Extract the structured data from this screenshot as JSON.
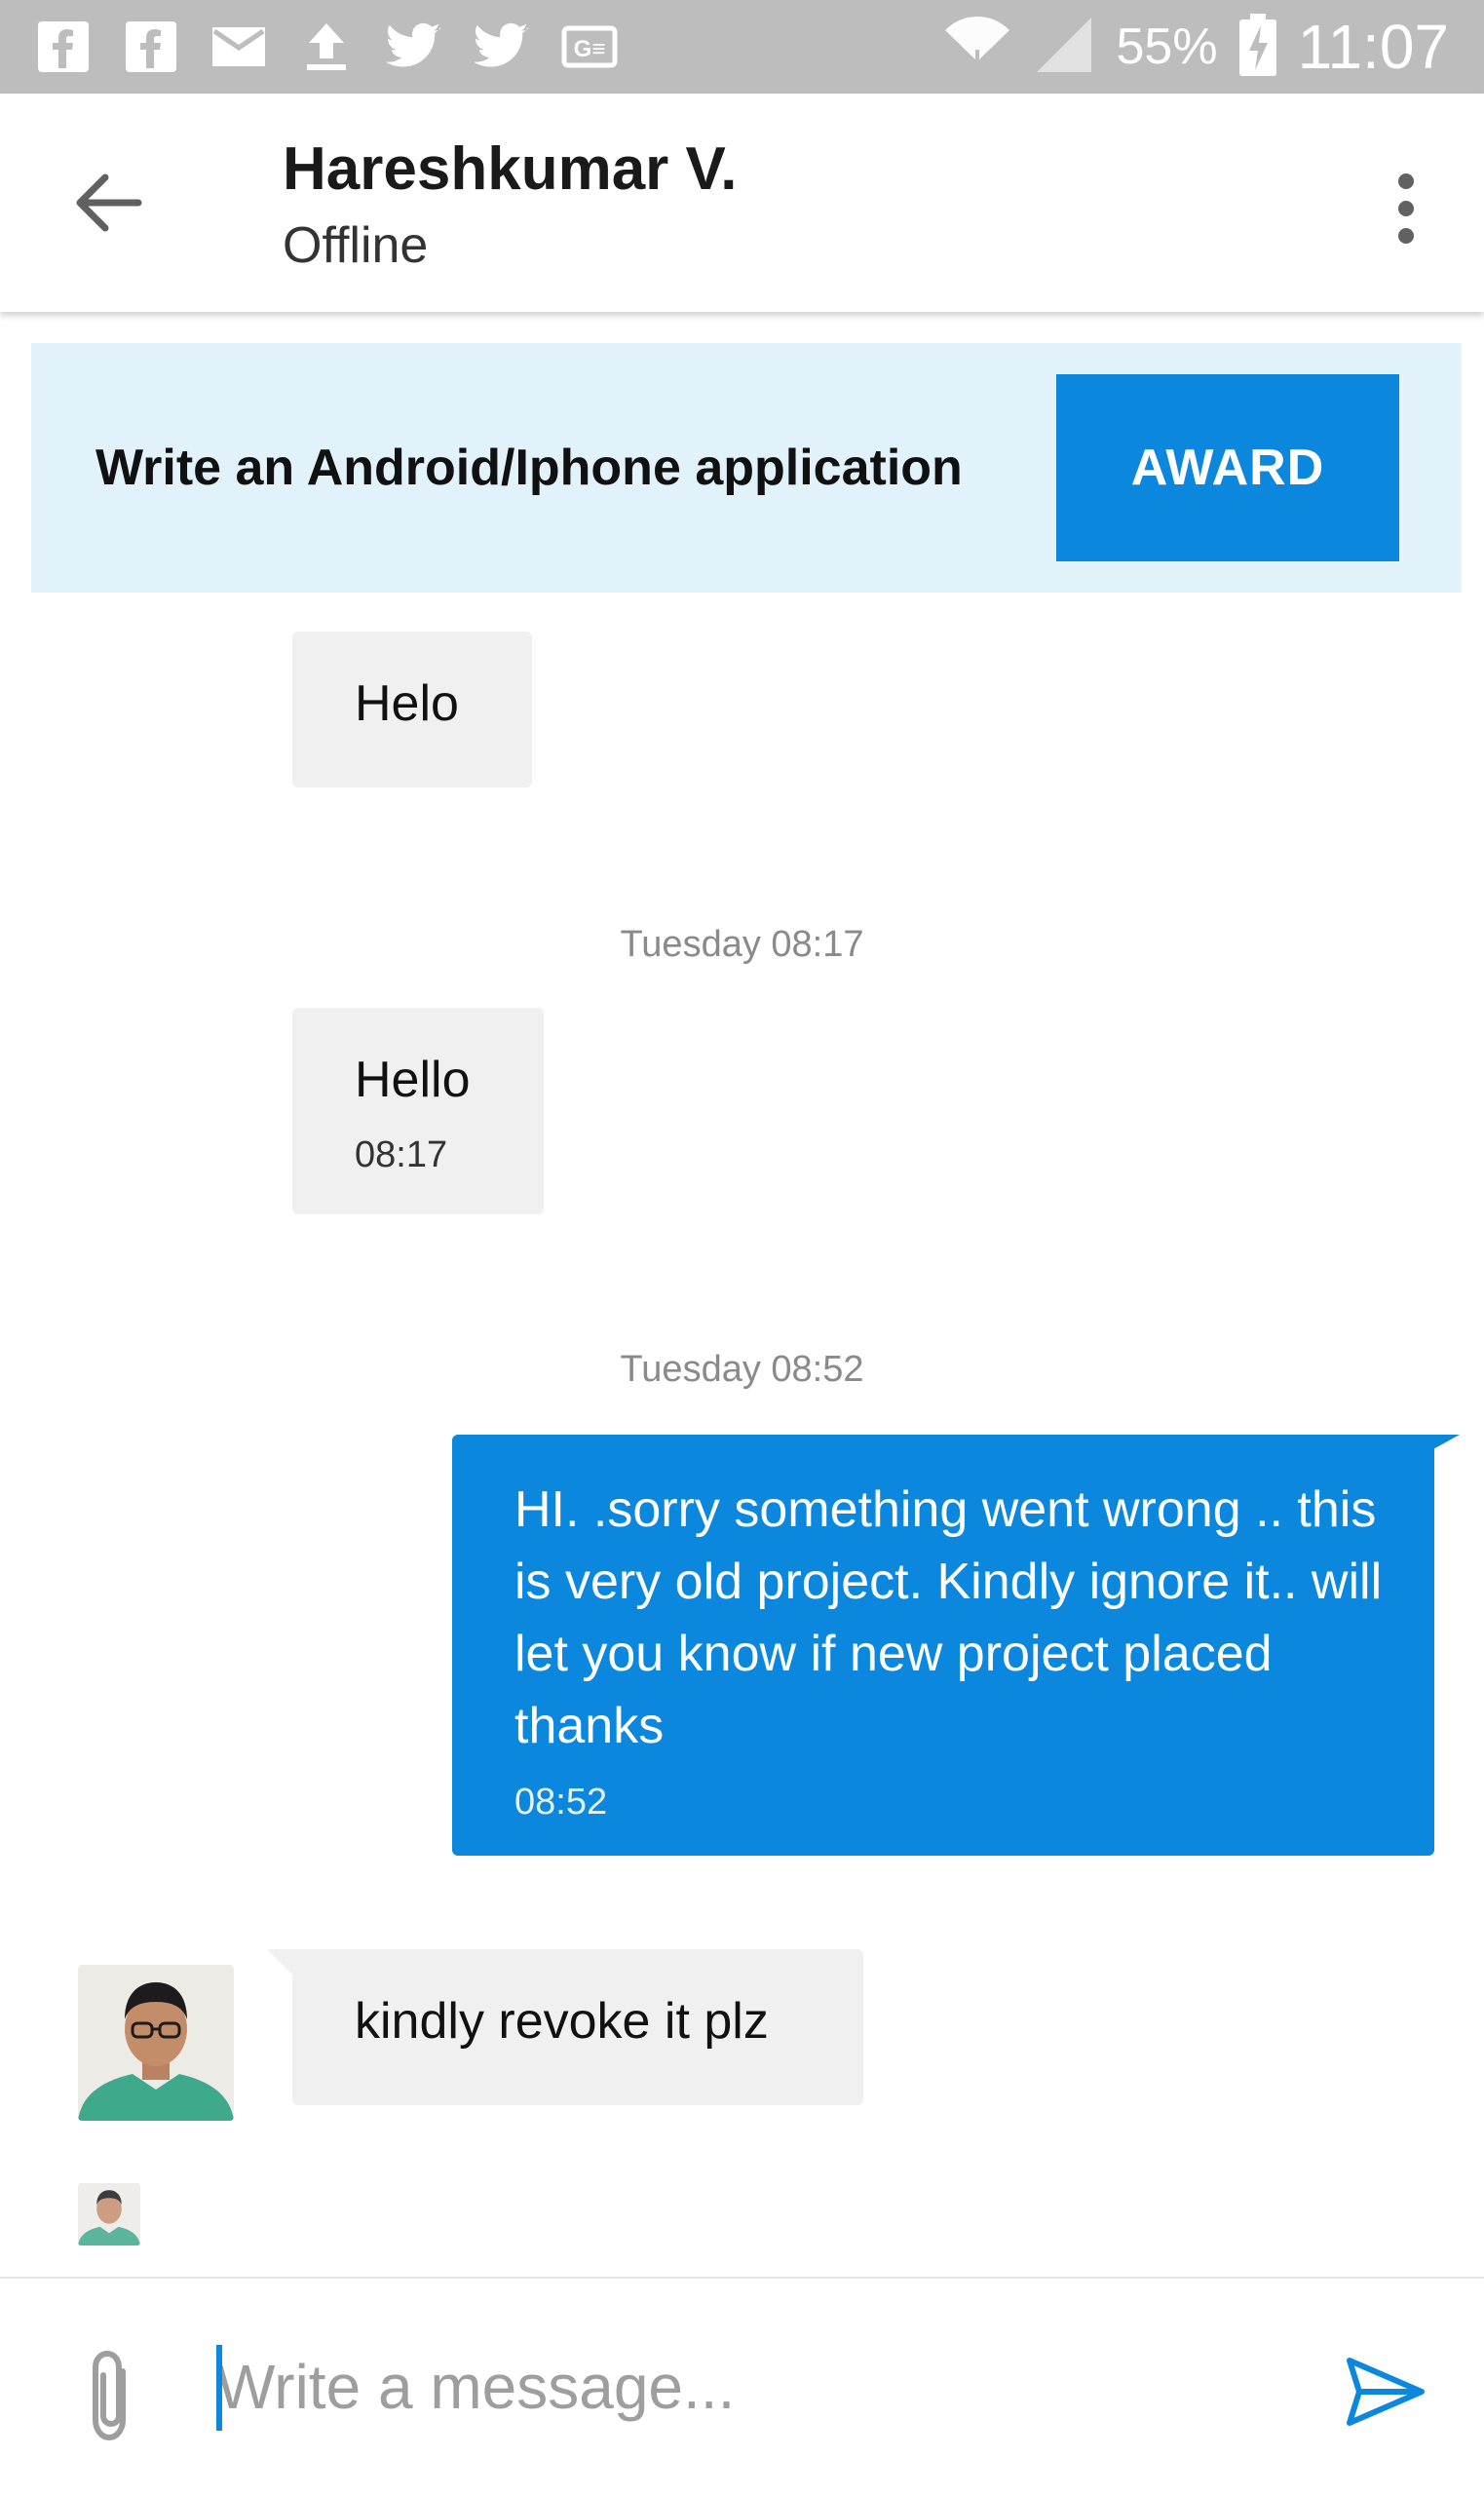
{
  "status_bar": {
    "icons": [
      "facebook-icon",
      "facebook-icon",
      "mail-icon",
      "upload-icon",
      "twitter-icon",
      "twitter-icon",
      "translate-icon"
    ],
    "battery_percent": "55%",
    "time": "11:07"
  },
  "header": {
    "contact_name": "Hareshkumar V.",
    "presence": "Offline"
  },
  "banner": {
    "project_title": "Write an Android/Iphone application",
    "award_label": "AWARD"
  },
  "messages": [
    {
      "direction": "incoming",
      "text": "Helo"
    },
    {
      "divider": "Tuesday 08:17"
    },
    {
      "direction": "incoming",
      "text": "Hello",
      "time": "08:17"
    },
    {
      "divider": "Tuesday 08:52"
    },
    {
      "direction": "outgoing",
      "text": "HI. .sorry something went wrong .. this is very old project.  Kindly ignore it.. will let you know if new project placed thanks",
      "time": "08:52"
    },
    {
      "direction": "incoming",
      "text": "kindly revoke it plz"
    }
  ],
  "composer": {
    "placeholder": "Write a message..."
  },
  "colors": {
    "accent": "#0b87dd",
    "banner_bg": "#e1f2fb",
    "incoming_bubble": "#f0f0f0",
    "status_bar": "#bdbdbd"
  }
}
